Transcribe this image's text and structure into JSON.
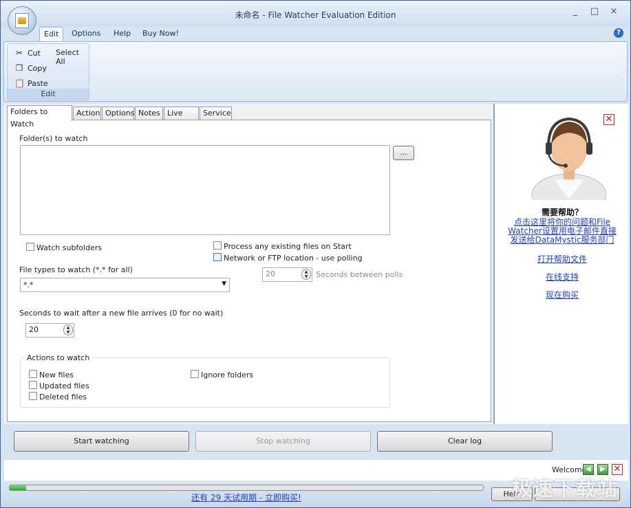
{
  "window": {
    "title": "未命名 - File Watcher Evaluation Edition",
    "minimize": "_",
    "maximize": "□",
    "close": "×"
  },
  "ribbon": {
    "tabs": [
      "Edit",
      "Options",
      "Help",
      "Buy Now!"
    ],
    "help_icon": "?",
    "group": {
      "label": "Edit",
      "cut": "Cut",
      "copy": "Copy",
      "paste": "Paste",
      "select_all": "Select All"
    }
  },
  "tabs": [
    "Folders to Watch",
    "Action",
    "Options",
    "Notes",
    "Live Log",
    "Service"
  ],
  "folders": {
    "folders_label": "Folder(s) to watch",
    "browse": "...",
    "watch_subfolders": "Watch subfolders",
    "process_existing": "Process any existing files on Start",
    "network_polling": "Network or FTP location - use polling",
    "poll_value": "20",
    "poll_label": "Seconds between polls",
    "file_types_label": "File types to watch (*.* for all)",
    "file_types_value": "*.*",
    "wait_label": "Seconds to wait after a new file arrives (0 for no wait)",
    "wait_value": "20",
    "actions_title": "Actions to watch",
    "new_files": "New files",
    "updated_files": "Updated files",
    "deleted_files": "Deleted files",
    "ignore_folders": "Ignore folders"
  },
  "help_pane": {
    "heading": "需要帮助？",
    "link1_line1": "点击这里将你的问题和File",
    "link1_line2": "Watcher设置用电子邮件直接",
    "link1_line3": "发送给DataMystic服务部门",
    "open_help": "打开帮助文件",
    "online_support": "在线支持",
    "buy_now": "现在购买"
  },
  "buttons": {
    "start": "Start watching",
    "stop": "Stop watching",
    "clear": "Clear log"
  },
  "welcome": {
    "label": "Welcome"
  },
  "statusbar": {
    "trial_link": "还有 29 天试用期 - 立即购买!",
    "help_btn": "Help",
    "progress": 0.035,
    "watermark": "极速下载站"
  }
}
